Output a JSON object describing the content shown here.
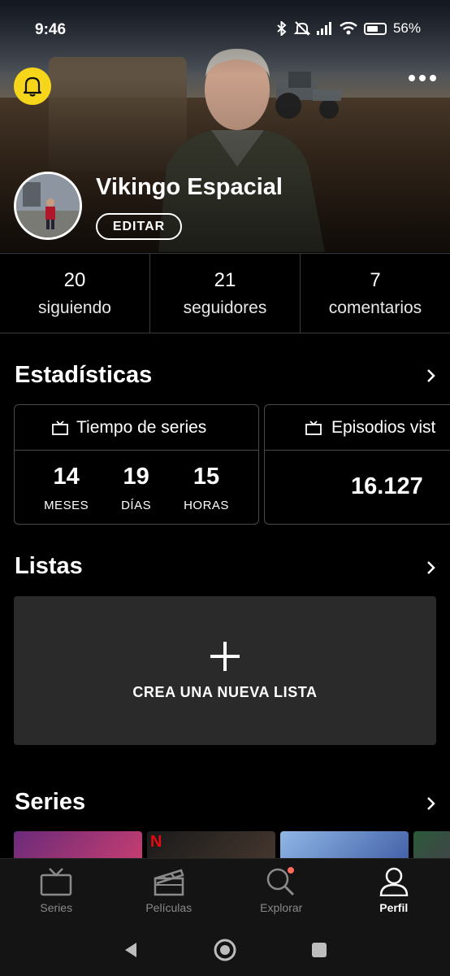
{
  "status_bar": {
    "time": "9:46",
    "battery": "56%",
    "icons": [
      "bluetooth-icon",
      "mute-icon",
      "signal-icon",
      "wifi-icon",
      "battery-icon"
    ]
  },
  "profile": {
    "username": "Vikingo Espacial",
    "edit_label": "EDITAR"
  },
  "counters": [
    {
      "value": "20",
      "label": "siguiendo"
    },
    {
      "value": "21",
      "label": "seguidores"
    },
    {
      "value": "7",
      "label": "comentarios"
    }
  ],
  "statistics": {
    "title": "Estadísticas",
    "series_time": {
      "title": "Tiempo de series",
      "units": [
        {
          "value": "14",
          "label": "MESES"
        },
        {
          "value": "19",
          "label": "DÍAS"
        },
        {
          "value": "15",
          "label": "HORAS"
        }
      ]
    },
    "episodes": {
      "title": "Episodios vist",
      "value": "16.127"
    }
  },
  "lists": {
    "title": "Listas",
    "create_label": "CREA UNA NUEVA LISTA",
    "plus": "+"
  },
  "series_section": {
    "title": "Series"
  },
  "tabs": [
    {
      "label": "Series",
      "icon": "tv-icon"
    },
    {
      "label": "Películas",
      "icon": "clapperboard-icon"
    },
    {
      "label": "Explorar",
      "icon": "search-icon"
    },
    {
      "label": "Perfil",
      "icon": "person-icon"
    }
  ],
  "active_tab": "Perfil",
  "colors": {
    "accent_bell": "#f5d61a",
    "background": "#000000",
    "card_border": "#4a4a4a",
    "notification_dot": "#ff6b5a"
  }
}
